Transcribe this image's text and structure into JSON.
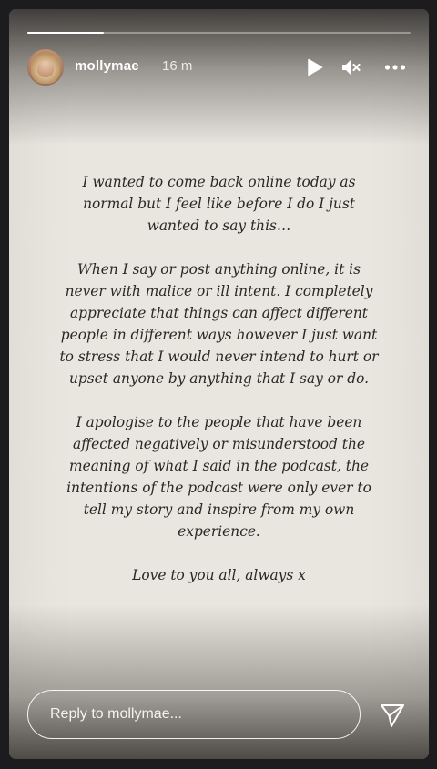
{
  "story": {
    "progress_fraction": 0.2,
    "user": {
      "username": "mollymae",
      "time_ago": "16 m"
    },
    "controls": {
      "play_icon": "play-icon",
      "mute_icon": "speaker-muted-icon",
      "more_icon": "more-horizontal-icon"
    },
    "text": {
      "paragraph_1": "I wanted to come back online today as normal but I feel like before I do I just wanted to say this…",
      "paragraph_2": "When I say or post anything online, it is never with malice or ill intent. I completely appreciate that things can affect different people in different ways however I just want to stress that I would never intend to hurt or upset anyone by anything that I say or do.",
      "paragraph_3": "I apologise to the people that have been affected negatively or misunderstood the meaning of what I said in the podcast, the intentions of the podcast were only ever to tell my story and inspire from my own experience.",
      "paragraph_4": "Love to you all, always x"
    },
    "reply": {
      "placeholder": "Reply to mollymae...",
      "send_icon": "send-icon"
    }
  }
}
